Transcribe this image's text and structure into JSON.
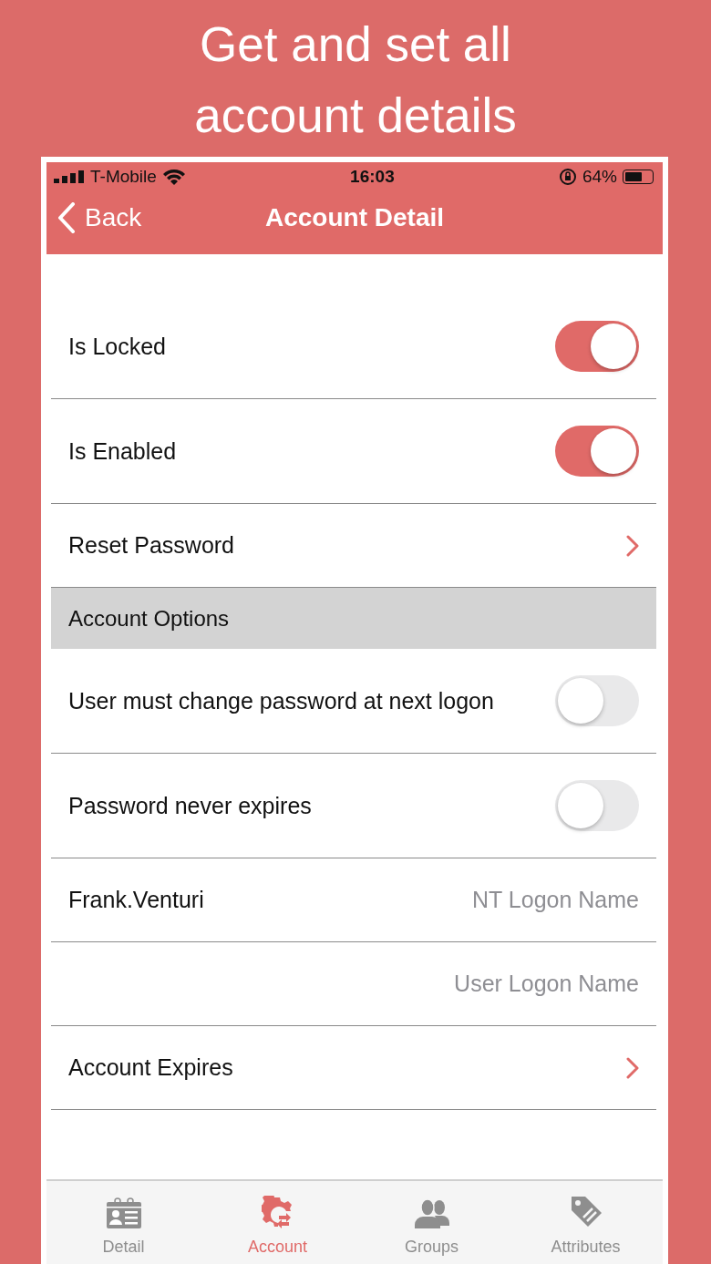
{
  "headline": "Get and set all account details",
  "status_bar": {
    "carrier": "T-Mobile",
    "time": "16:03",
    "battery": "64%"
  },
  "nav_bar": {
    "back": "Back",
    "title": "Account Detail"
  },
  "rows": [
    {
      "kind": "toggle",
      "label": "Is Locked",
      "on": true
    },
    {
      "kind": "toggle",
      "label": "Is Enabled",
      "on": true
    },
    {
      "kind": "link",
      "label": "Reset Password"
    },
    {
      "kind": "section",
      "label": "Account Options"
    },
    {
      "kind": "toggle",
      "label": "User must change password at next logon",
      "on": false
    },
    {
      "kind": "toggle",
      "label": "Password never expires",
      "on": false
    },
    {
      "kind": "field",
      "value": "Frank.Venturi",
      "label": "NT Logon Name"
    },
    {
      "kind": "field",
      "label": "User Logon Name"
    },
    {
      "kind": "link",
      "label": "Account Expires"
    }
  ],
  "tabs": [
    {
      "label": "Detail",
      "selected": false
    },
    {
      "label": "Account",
      "selected": true
    },
    {
      "label": "Groups",
      "selected": false
    },
    {
      "label": "Attributes",
      "selected": false
    }
  ]
}
